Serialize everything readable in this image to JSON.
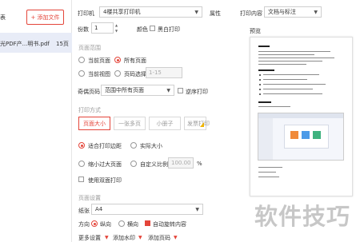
{
  "left": {
    "partial_title": "表",
    "add_button": "+ 添加文件",
    "file_name": "光PDF产...明书.pdf",
    "file_pages": "15页"
  },
  "printer": {
    "label": "打印机",
    "value": "4楼共享打印机",
    "properties": "属性"
  },
  "print_content": {
    "label": "打印内容",
    "value": "文档与标注"
  },
  "copies": {
    "label": "份数",
    "value": "1"
  },
  "color": {
    "label": "颜色",
    "grayscale_label": "黑白打印",
    "grayscale_checked": false
  },
  "page_range": {
    "section": "页面范围",
    "options": [
      {
        "label": "当前页面",
        "checked": false
      },
      {
        "label": "所有页面",
        "checked": true
      },
      {
        "label": "当前视图",
        "checked": false
      },
      {
        "label": "页码选择",
        "checked": false
      }
    ],
    "page_input_placeholder": "1-15"
  },
  "odd_even": {
    "label": "奇偶页码",
    "value": "范围中所有页面",
    "reverse_label": "逆序打印",
    "reverse_checked": false
  },
  "print_mode": {
    "section": "打印方式",
    "tabs": [
      "页面大小",
      "一张多页",
      "小册子",
      "发票打印"
    ],
    "active_tab": 0,
    "options": [
      {
        "label": "适合打印边距",
        "checked": true
      },
      {
        "label": "实际大小",
        "checked": false
      },
      {
        "label": "缩小过大页面",
        "checked": false
      },
      {
        "label": "自定义比例",
        "checked": false
      }
    ],
    "scale_value": "100.00",
    "scale_unit": "%",
    "duplex_label": "使用双面打印",
    "duplex_checked": false
  },
  "page_setup": {
    "section": "页面设置",
    "paper_label": "纸张",
    "paper_value": "A4",
    "orientation_label": "方向",
    "orientation_options": [
      {
        "label": "纵向",
        "checked": true
      },
      {
        "label": "横向",
        "checked": false
      }
    ],
    "auto_rotate_label": "自动旋转内容",
    "auto_rotate_checked": true
  },
  "more": {
    "more_settings": "更多设置",
    "add_watermark": "添加水印",
    "add_header_footer": "添加页码"
  },
  "preview": {
    "label": "预览"
  },
  "watermark_text": "软件技巧",
  "colors": {
    "accent": "#e4453a",
    "selected_row": "#e8ecf7"
  }
}
